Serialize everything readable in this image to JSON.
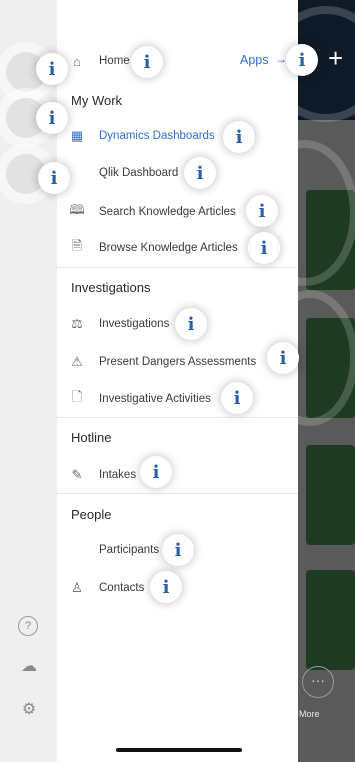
{
  "background": {
    "plus_label": "+",
    "more_glyph": "···",
    "more_label": "More"
  },
  "rail": {
    "icons": [
      "user-icon",
      "compass-icon",
      "pin-icon"
    ],
    "bottom_icons": [
      "help-icon",
      "cloud-icon",
      "settings-icon"
    ],
    "help_glyph": "?",
    "cloud_glyph": "☁",
    "settings_glyph": "⚙"
  },
  "drawer": {
    "home": {
      "label": "Home",
      "icon": "home-icon",
      "glyph": "⌂"
    },
    "apps_label": "Apps",
    "apps_arrow": "→",
    "sections": {
      "my_work": "My Work",
      "investigations": "Investigations",
      "hotline": "Hotline",
      "people": "People"
    },
    "my_work_items": [
      {
        "label": "Dynamics Dashboards",
        "icon": "dashboard-icon",
        "glyph": "▦",
        "active": true
      },
      {
        "label": "Qlik Dashboard",
        "icon": "qlik-icon",
        "glyph": "",
        "active": false
      },
      {
        "label": "Search Knowledge Articles",
        "icon": "book-icon",
        "glyph": "🕮",
        "active": false
      },
      {
        "label": "Browse Knowledge Articles",
        "icon": "document-icon",
        "glyph": "🗎",
        "active": false
      }
    ],
    "investigation_items": [
      {
        "label": "Investigations",
        "icon": "gavel-icon",
        "glyph": "⚖"
      },
      {
        "label": "Present Dangers Assessments",
        "icon": "hazard-icon",
        "glyph": "⚠"
      },
      {
        "label": "Investigative Activities",
        "icon": "file-icon",
        "glyph": "🗋"
      }
    ],
    "hotline_items": [
      {
        "label": "Intakes",
        "icon": "edit-icon",
        "glyph": "✎"
      }
    ],
    "people_items": [
      {
        "label": "Participants",
        "icon": "participants-icon",
        "glyph": ""
      },
      {
        "label": "Contacts",
        "icon": "person-icon",
        "glyph": "♙"
      }
    ]
  },
  "info_badge": {
    "glyph": "i"
  }
}
